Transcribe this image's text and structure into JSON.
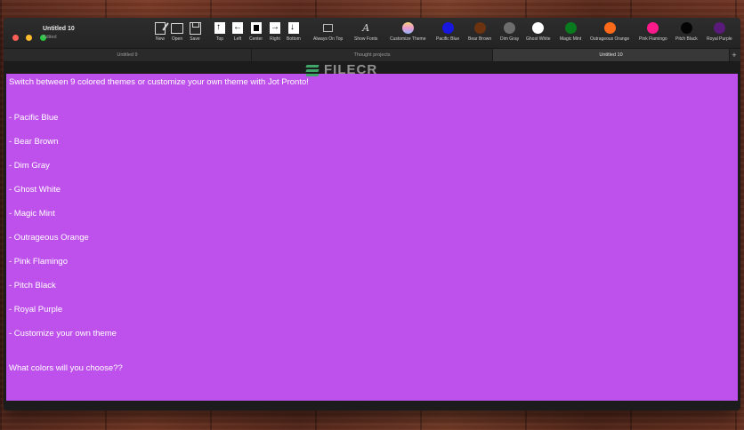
{
  "window": {
    "doc_title": "Untitled 10",
    "doc_status": "Edited"
  },
  "toolbar": {
    "file_tools": [
      {
        "label": "New",
        "icon": "new-document-icon"
      },
      {
        "label": "Open",
        "icon": "folder-icon"
      },
      {
        "label": "Save",
        "icon": "save-icon"
      }
    ],
    "position_tools": [
      {
        "label": "Top",
        "icon": "position-top-icon"
      },
      {
        "label": "Left",
        "icon": "position-left-icon"
      },
      {
        "label": "Center",
        "icon": "position-center-icon"
      },
      {
        "label": "Right",
        "icon": "position-right-icon"
      },
      {
        "label": "Bottom",
        "icon": "position-bottom-icon"
      }
    ],
    "always_on_top_label": "Always On Top",
    "font_label": "Show Fonts",
    "customize_theme_label": "Customize Theme",
    "themes": [
      {
        "label": "Pacific Blue",
        "color": "#1717e0"
      },
      {
        "label": "Bear Brown",
        "color": "#6b3310"
      },
      {
        "label": "Dim Gray",
        "color": "#6d6d6d"
      },
      {
        "label": "Ghost White",
        "color": "#ffffff"
      },
      {
        "label": "Magic Mint",
        "color": "#0a7a1e"
      },
      {
        "label": "Outrageous Orange",
        "color": "#ff6a1a"
      },
      {
        "label": "Pink Flamingo",
        "color": "#ff1a8c"
      },
      {
        "label": "Pitch Black",
        "color": "#050505"
      },
      {
        "label": "Royal Purple",
        "color": "#5a1a7a"
      }
    ]
  },
  "tabs": [
    {
      "label": "Untitled 9",
      "active": false
    },
    {
      "label": "Thought projects",
      "active": false
    },
    {
      "label": "Untitled 10",
      "active": true
    }
  ],
  "watermark": "FILECR",
  "editor": {
    "background": "#be50ec",
    "lines": [
      "Switch between 9 colored themes or customize your own theme with Jot Pronto!",
      "- Pacific Blue",
      "- Bear Brown",
      "- Dim Gray",
      "- Ghost White",
      "- Magic Mint",
      "- Outrageous Orange",
      "- Pink Flamingo",
      "- Pitch Black",
      "- Royal Purple",
      "- Customize your own theme",
      "What colors will you choose??"
    ]
  }
}
